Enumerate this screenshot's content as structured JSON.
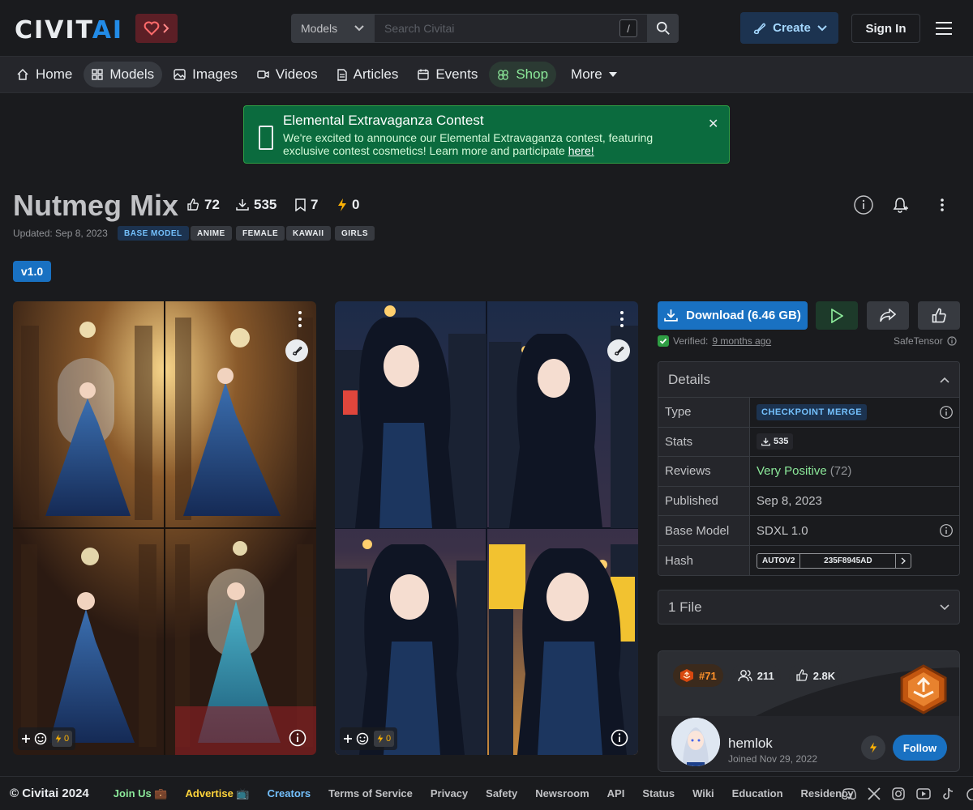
{
  "header": {
    "logo_civit": "CIVIT",
    "logo_ai": "AI",
    "search_scope": "Models",
    "search_placeholder": "Search Civitai",
    "search_shortcut": "/",
    "create_label": "Create",
    "signin_label": "Sign In"
  },
  "nav": {
    "items": [
      {
        "label": "Home",
        "icon": "home-icon"
      },
      {
        "label": "Models",
        "icon": "grid-icon"
      },
      {
        "label": "Images",
        "icon": "image-icon"
      },
      {
        "label": "Videos",
        "icon": "video-icon"
      },
      {
        "label": "Articles",
        "icon": "file-icon"
      },
      {
        "label": "Events",
        "icon": "calendar-icon"
      },
      {
        "label": "Shop",
        "icon": "clover-icon"
      },
      {
        "label": "More",
        "icon": "caret-down-icon"
      }
    ]
  },
  "banner": {
    "title": "Elemental Extravaganza Contest",
    "text": "We're excited to announce our Elemental Extravaganza contest, featuring exclusive contest cosmetics! Learn more and participate ",
    "link": "here!"
  },
  "model": {
    "title": "Nutmeg Mix",
    "likes": "72",
    "downloads": "535",
    "collected": "7",
    "buzz": "0",
    "updated": "Updated: Sep 8, 2023",
    "base_tag": "BASE MODEL",
    "tags": [
      "ANIME",
      "FEMALE",
      "KAWAII",
      "GIRLS"
    ],
    "version": "v1.0"
  },
  "gallery": {
    "card1_buzz": "0",
    "card2_buzz": "0"
  },
  "download": {
    "label": "Download (6.46 GB)",
    "verified_prefix": "Verified:",
    "verified_when": "9 months ago",
    "format": "SafeTensor"
  },
  "details": {
    "heading": "Details",
    "rows": {
      "type_label": "Type",
      "type_value": "CHECKPOINT MERGE",
      "stats_label": "Stats",
      "stats_value": "535",
      "reviews_label": "Reviews",
      "reviews_value": "Very Positive",
      "reviews_count": "(72)",
      "published_label": "Published",
      "published_value": "Sep 8, 2023",
      "base_label": "Base Model",
      "base_value": "SDXL 1.0",
      "hash_label": "Hash",
      "hash_type": "AUTOV2",
      "hash_value": "235F8945AD"
    }
  },
  "files": {
    "label": "1 File"
  },
  "creator": {
    "rank": "#71",
    "followers": "211",
    "likes": "2.8K",
    "name": "hemlok",
    "joined": "Joined Nov 29, 2022",
    "follow_label": "Follow"
  },
  "footer": {
    "copyright": "© Civitai 2024",
    "links": [
      "Join Us 💼",
      "Advertise 📺",
      "Creators",
      "Terms of Service",
      "Privacy",
      "Safety",
      "Newsroom",
      "API",
      "Status",
      "Wiki",
      "Education",
      "Residency"
    ]
  },
  "colors": {
    "accent": "#1971c2",
    "background": "#1a1b1e",
    "banner": "#0b6b3e",
    "positive": "#8ce99a"
  }
}
